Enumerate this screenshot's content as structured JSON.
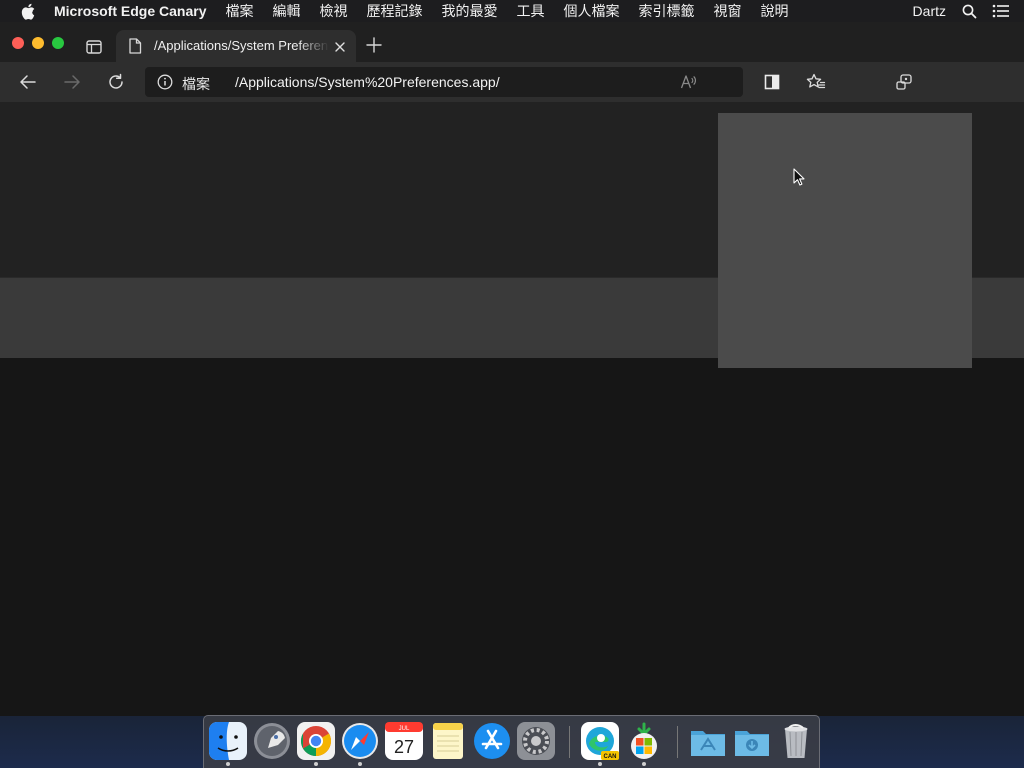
{
  "menubar": {
    "app_name": "Microsoft Edge Canary",
    "items": [
      "檔案",
      "編輯",
      "檢視",
      "歷程記錄",
      "我的最愛",
      "工具",
      "個人檔案",
      "索引標籤",
      "視窗",
      "說明"
    ],
    "user": "Dartz",
    "icons": [
      "apple-icon",
      "search-icon",
      "control-center-icon"
    ]
  },
  "tab": {
    "title": "/Applications/System Preferences",
    "favicon": "page-icon"
  },
  "toolbar": {
    "address": {
      "scheme_label": "檔案",
      "url": "/Applications/System%20Preferences.app/"
    },
    "icons": [
      "back-icon",
      "forward-icon",
      "refresh-icon",
      "info-icon",
      "read-aloud-icon",
      "split-screen-icon",
      "favorites-icon",
      "collections-icon"
    ]
  },
  "dock": {
    "apps": [
      {
        "name": "Finder",
        "icon": "finder-icon",
        "running": true
      },
      {
        "name": "Launchpad",
        "icon": "launchpad-icon",
        "running": false
      },
      {
        "name": "Google Chrome",
        "icon": "chrome-icon",
        "running": true
      },
      {
        "name": "Safari",
        "icon": "safari-icon",
        "running": true
      },
      {
        "name": "Calendar",
        "icon": "calendar-icon",
        "running": false,
        "day": "27",
        "month": "JUL"
      },
      {
        "name": "Notes",
        "icon": "notes-icon",
        "running": false
      },
      {
        "name": "App Store",
        "icon": "app-store-icon",
        "running": false
      },
      {
        "name": "System Preferences",
        "icon": "system-preferences-icon",
        "running": false
      },
      {
        "name": "Microsoft Edge Canary",
        "icon": "edge-canary-icon",
        "running": true,
        "badge": "CAN"
      },
      {
        "name": "Microsoft Installer",
        "icon": "installer-icon",
        "running": true
      },
      {
        "name": "Applications",
        "icon": "applications-folder-icon",
        "running": false
      },
      {
        "name": "Downloads",
        "icon": "downloads-folder-icon",
        "running": false
      },
      {
        "name": "Trash",
        "icon": "trash-icon",
        "running": false
      }
    ]
  },
  "colors": {
    "menubar_bg": "#1d1d1f",
    "toolbar_bg": "#2e2e2e",
    "page_bg": "#161616",
    "panel_bg": "#4b4b4b"
  }
}
